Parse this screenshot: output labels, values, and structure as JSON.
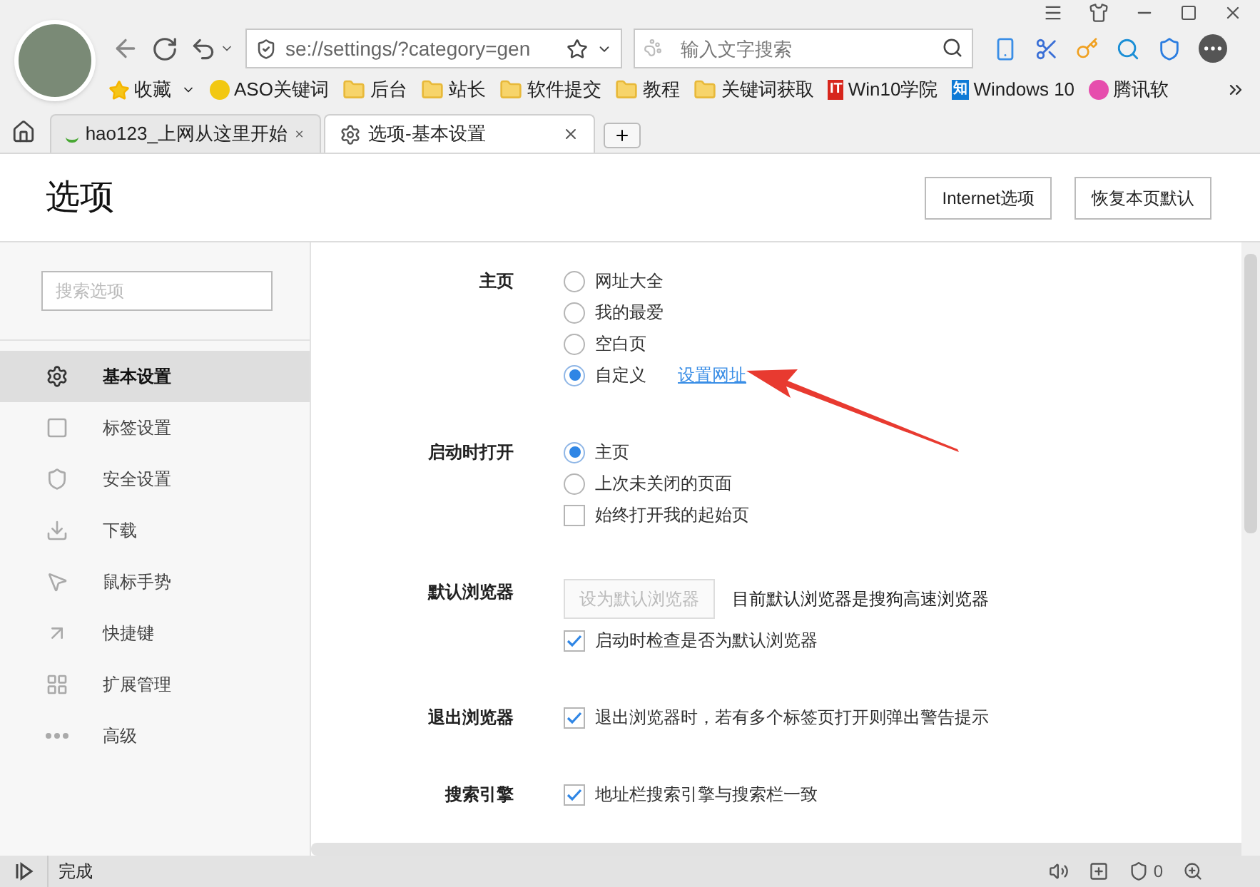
{
  "address": {
    "value": "se://settings/?category=gen"
  },
  "search": {
    "placeholder": "输入文字搜索"
  },
  "bookmarks": [
    {
      "kind": "favorites",
      "label": "收藏"
    },
    {
      "kind": "site",
      "label": "ASO关键词",
      "color": "#f2c811"
    },
    {
      "kind": "folder",
      "label": "后台"
    },
    {
      "kind": "folder",
      "label": "站长"
    },
    {
      "kind": "folder",
      "label": "软件提交"
    },
    {
      "kind": "folder",
      "label": "教程"
    },
    {
      "kind": "folder",
      "label": "关键词获取"
    },
    {
      "kind": "badge",
      "label": "Win10学院",
      "badge": "IT",
      "color": "#d7261c"
    },
    {
      "kind": "badge",
      "label": "Windows 10",
      "badge": "知",
      "color": "#0e7ad6"
    },
    {
      "kind": "site",
      "label": "腾讯软",
      "color": "#e64dad"
    }
  ],
  "tabs": [
    {
      "label": "hao123_上网从这里开始",
      "selected": false
    },
    {
      "label": "选项-基本设置",
      "selected": true
    }
  ],
  "page": {
    "title": "选项",
    "buttons": [
      "Internet选项",
      "恢复本页默认"
    ]
  },
  "sidebar": {
    "search_placeholder": "搜索选项",
    "items": [
      {
        "label": "基本设置",
        "selected": true
      },
      {
        "label": "标签设置",
        "selected": false
      },
      {
        "label": "安全设置",
        "selected": false
      },
      {
        "label": "下载",
        "selected": false
      },
      {
        "label": "鼠标手势",
        "selected": false
      },
      {
        "label": "快捷键",
        "selected": false
      },
      {
        "label": "扩展管理",
        "selected": false
      },
      {
        "label": "高级",
        "selected": false
      }
    ]
  },
  "sections": [
    {
      "label": "主页",
      "options": [
        {
          "kind": "radio",
          "label": "网址大全",
          "checked": false
        },
        {
          "kind": "radio",
          "label": "我的最爱",
          "checked": false
        },
        {
          "kind": "radio",
          "label": "空白页",
          "checked": false
        },
        {
          "kind": "radio",
          "label": "自定义",
          "checked": true,
          "link": "设置网址"
        }
      ]
    },
    {
      "label": "启动时打开",
      "options": [
        {
          "kind": "radio",
          "label": "主页",
          "checked": true
        },
        {
          "kind": "radio",
          "label": "上次未关闭的页面",
          "checked": false
        },
        {
          "kind": "checkbox",
          "label": "始终打开我的起始页",
          "checked": false
        }
      ]
    },
    {
      "label": "默认浏览器",
      "options": [
        {
          "kind": "button",
          "label": "设为默认浏览器",
          "disabled": true,
          "note": "目前默认浏览器是搜狗高速浏览器"
        },
        {
          "kind": "checkbox",
          "label": "启动时检查是否为默认浏览器",
          "checked": true
        }
      ]
    },
    {
      "label": "退出浏览器",
      "options": [
        {
          "kind": "checkbox",
          "label": "退出浏览器时，若有多个标签页打开则弹出警告提示",
          "checked": true
        }
      ]
    },
    {
      "label": "搜索引擎",
      "options": [
        {
          "kind": "checkbox",
          "label": "地址栏搜索引擎与搜索栏一致",
          "checked": true
        }
      ]
    }
  ],
  "status_bar": {
    "text": "完成",
    "count": "0"
  }
}
